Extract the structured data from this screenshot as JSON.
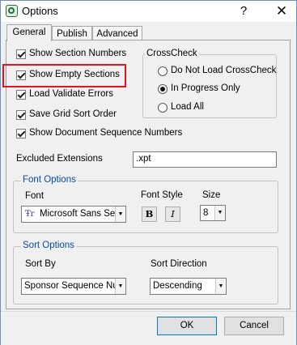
{
  "window": {
    "title": "Options",
    "help_label": "?",
    "close_label": "✕"
  },
  "tabs": [
    {
      "label": "General",
      "active": true
    },
    {
      "label": "Publish",
      "active": false
    },
    {
      "label": "Advanced",
      "active": false
    }
  ],
  "checkboxes": [
    {
      "label": "Show Section Numbers",
      "checked": true
    },
    {
      "label": "Show Empty Sections",
      "checked": true
    },
    {
      "label": "Load Validate Errors",
      "checked": true
    },
    {
      "label": "Save Grid Sort Order",
      "checked": true
    },
    {
      "label": "Show Document Sequence Numbers",
      "checked": true
    }
  ],
  "crosscheck": {
    "title": "CrossCheck",
    "options": [
      {
        "label": "Do Not Load CrossCheck",
        "selected": false
      },
      {
        "label": "In Progress Only",
        "selected": true
      },
      {
        "label": "Load All",
        "selected": false
      }
    ]
  },
  "excluded_extensions": {
    "label": "Excluded Extensions",
    "value": ".xpt"
  },
  "font_options": {
    "title": "Font Options",
    "font_label": "Font",
    "font_value": "Microsoft Sans Ser",
    "font_icon_glyph": "Ŧr",
    "style_label": "Font Style",
    "bold_glyph": "B",
    "italic_glyph": "I",
    "size_label": "Size",
    "size_value": "8"
  },
  "sort_options": {
    "title": "Sort Options",
    "sort_by_label": "Sort By",
    "sort_by_value": "Sponsor Sequence Nu",
    "direction_label": "Sort Direction",
    "direction_value": "Descending"
  },
  "buttons": {
    "ok": "OK",
    "cancel": "Cancel"
  },
  "colors": {
    "highlight": "#e3141b",
    "group_title": "#0a4aa3",
    "default_button_border": "#0078d7"
  }
}
